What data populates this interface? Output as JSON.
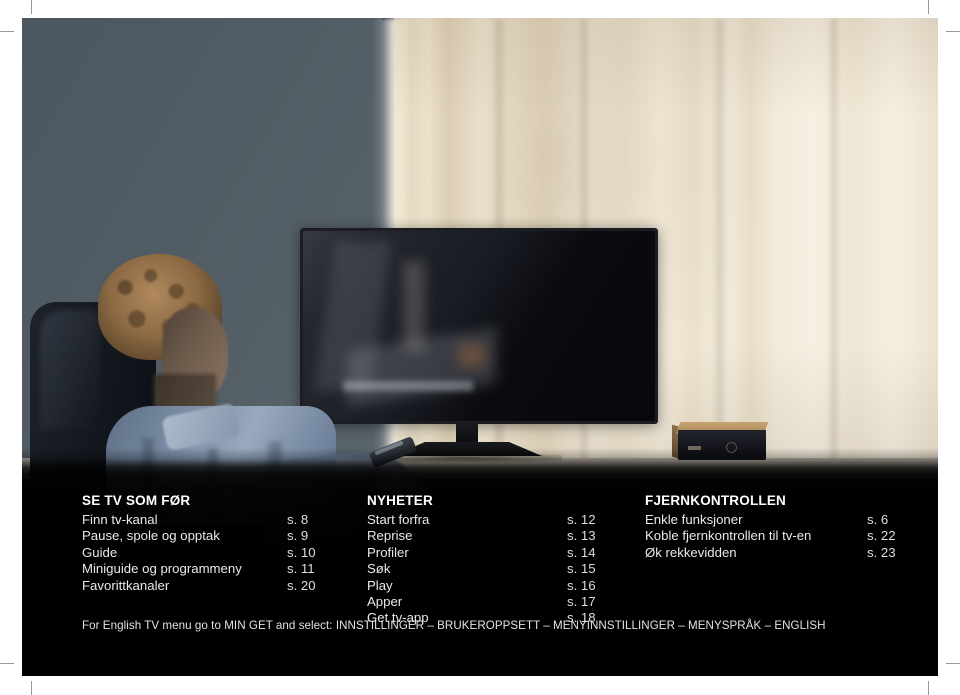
{
  "document": {
    "kind": "print-spread-index-page",
    "background_color": "#000000",
    "page_color": "#ffffff"
  },
  "photo": {
    "description": "Man with curly hair seated in a dark chair watching a switched-off flatscreen TV in front of a cream curtain, with a set-top box on the credenza",
    "wall_color": "#4c575f",
    "curtain_color": "#f2e8d2",
    "tv_color": "#0a0b10",
    "shirt_color": "#7b8ea6"
  },
  "index": {
    "columns": [
      {
        "heading": "SE TV SOM FØR",
        "entries": [
          {
            "title": "Finn tv-kanal",
            "page": "s. 8"
          },
          {
            "title": "Pause, spole og opptak",
            "page": "s. 9"
          },
          {
            "title": "Guide",
            "page": "s. 10"
          },
          {
            "title": "Miniguide og programmeny",
            "page": "s. 11"
          },
          {
            "title": "Favorittkanaler",
            "page": "s. 20"
          }
        ]
      },
      {
        "heading": "NYHETER",
        "entries": [
          {
            "title": "Start forfra",
            "page": "s. 12"
          },
          {
            "title": "Reprise",
            "page": "s. 13"
          },
          {
            "title": "Profiler",
            "page": "s. 14"
          },
          {
            "title": "Søk",
            "page": "s. 15"
          },
          {
            "title": "Play",
            "page": "s. 16"
          },
          {
            "title": "Apper",
            "page": "s. 17"
          },
          {
            "title": "Get tv-app",
            "page": "s. 18"
          }
        ]
      },
      {
        "heading": "FJERNKONTROLLEN",
        "entries": [
          {
            "title": "Enkle funksjoner",
            "page": "s. 6"
          },
          {
            "title": "Koble fjernkontrollen til tv-en",
            "page": "s. 22"
          },
          {
            "title": "Øk rekkevidden",
            "page": "s. 23"
          }
        ]
      }
    ]
  },
  "footnote": {
    "text": "For English TV menu go to MIN GET and select: INNSTILLINGER – BRUKEROPPSETT – MENYINNSTILLINGER – MENYSPRÅK – ENGLISH"
  }
}
